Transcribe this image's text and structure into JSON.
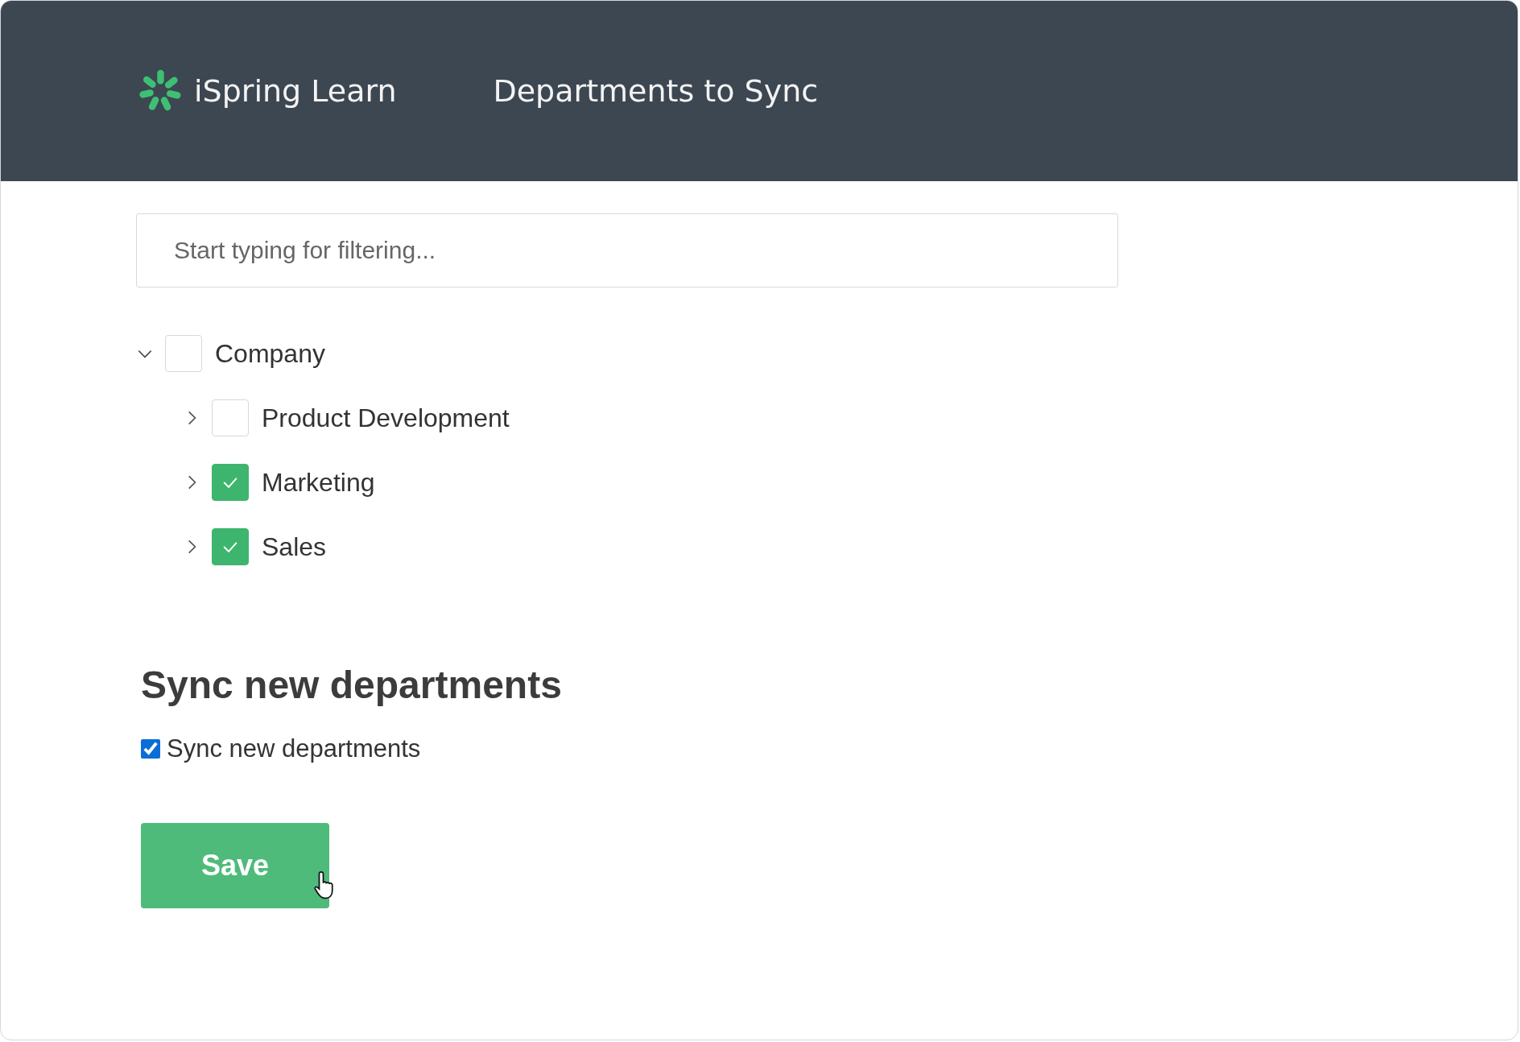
{
  "header": {
    "logo_text": "iSpring Learn",
    "title": "Departments to Sync"
  },
  "filter": {
    "placeholder": "Start typing for filtering..."
  },
  "tree": [
    {
      "label": "Company",
      "checked": false,
      "expanded": true,
      "children": [
        {
          "label": "Product Development",
          "checked": false,
          "expanded": false
        },
        {
          "label": "Marketing",
          "checked": true,
          "expanded": false
        },
        {
          "label": "Sales",
          "checked": true,
          "expanded": false
        }
      ]
    }
  ],
  "sync_section": {
    "heading": "Sync new departments",
    "option": {
      "label": "Sync new departments",
      "checked": true
    }
  },
  "buttons": [
    {
      "label": "Save"
    }
  ]
}
